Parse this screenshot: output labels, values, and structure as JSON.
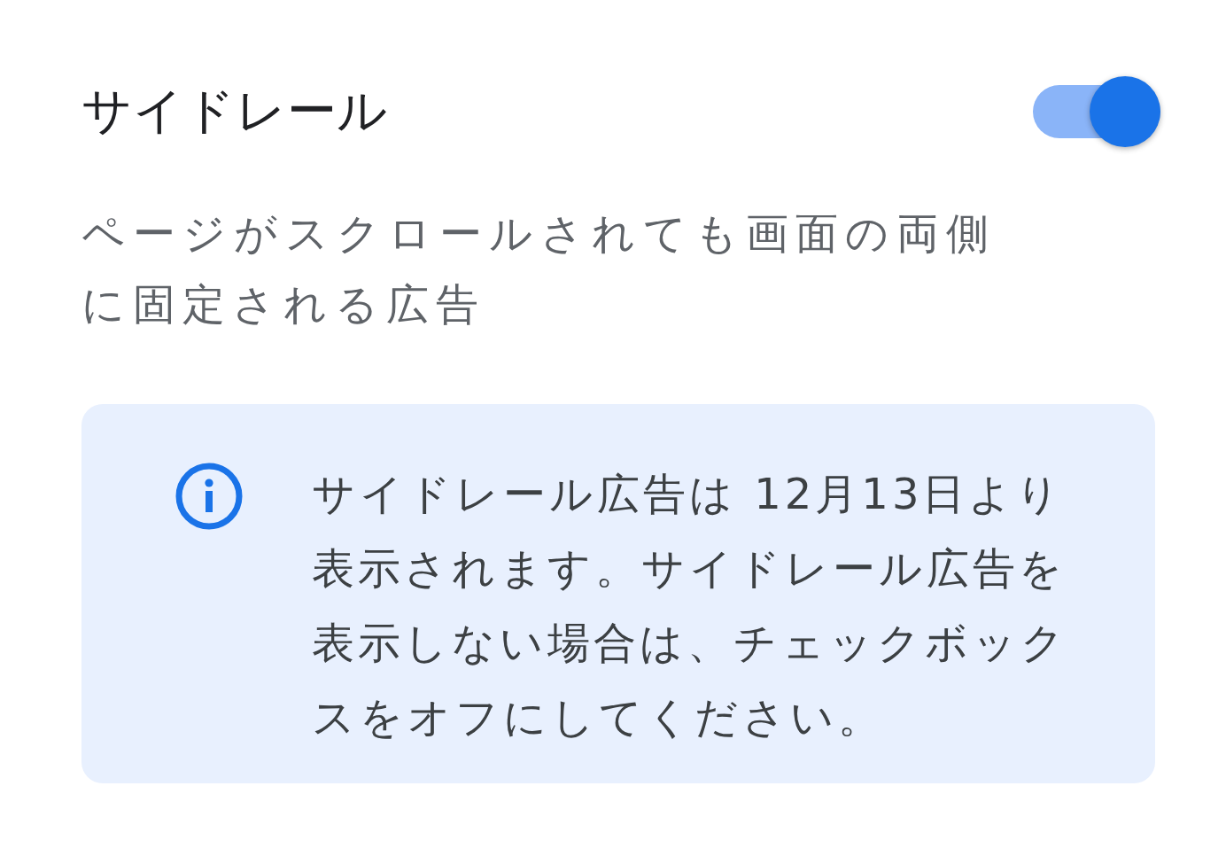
{
  "setting": {
    "title": "サイドレール",
    "on": true,
    "description": "ページがスクロールされても画面の両側に固定される広告"
  },
  "notice": {
    "text": "サイドレール広告は 12月13日より表示されます。サイドレール広告を表示しない場合は、チェックボックスをオフにしてください。"
  }
}
